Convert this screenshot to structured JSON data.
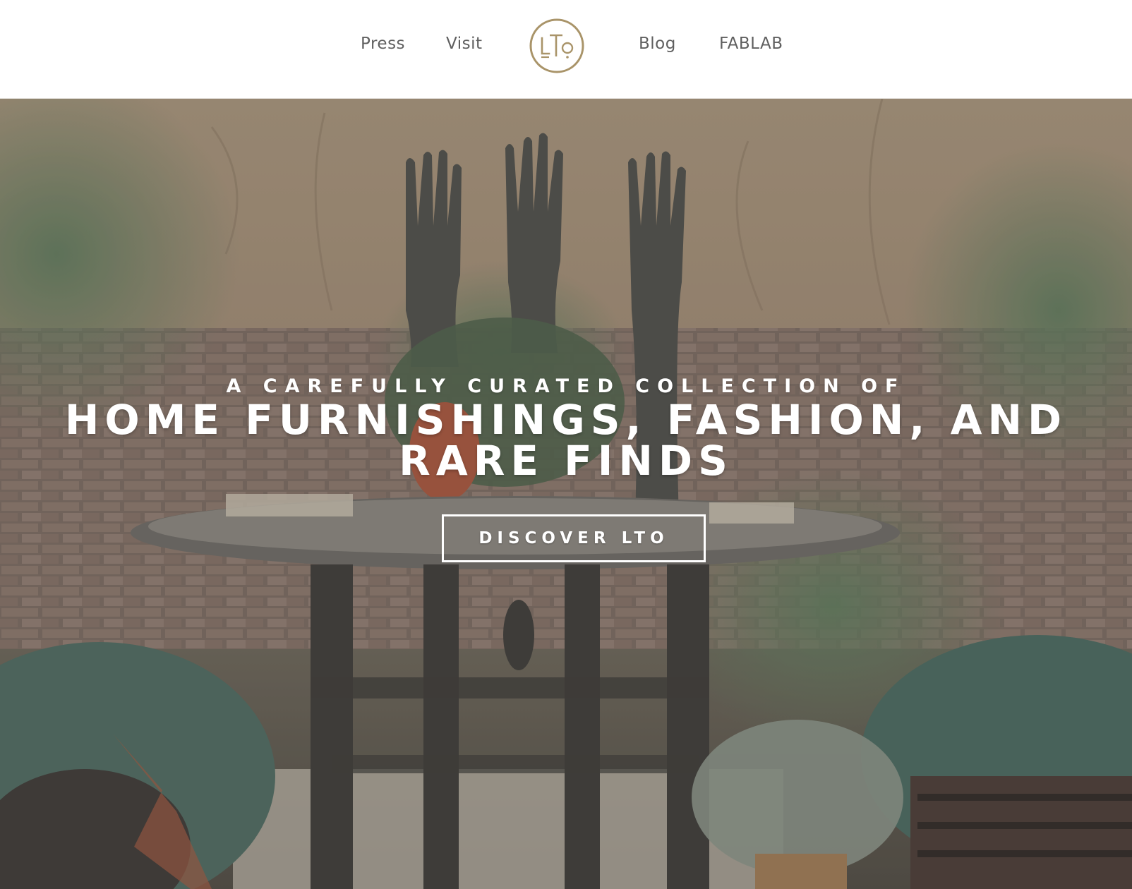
{
  "nav": {
    "left": [
      "Press",
      "Visit"
    ],
    "right": [
      "Blog",
      "FABLAB"
    ],
    "logo_text": "LTO",
    "logo_color": "#a99469"
  },
  "hero": {
    "kicker": "A CAREFULLY CURATED COLLECTION OF",
    "title": "HOME FURNISHINGS, FASHION, AND RARE FINDS",
    "cta_label": "DISCOVER LTO"
  },
  "colors": {
    "nav_text": "#5f5f5f",
    "hero_text": "#ffffff",
    "wall": "#a8957a",
    "brick": "#8a7668"
  }
}
